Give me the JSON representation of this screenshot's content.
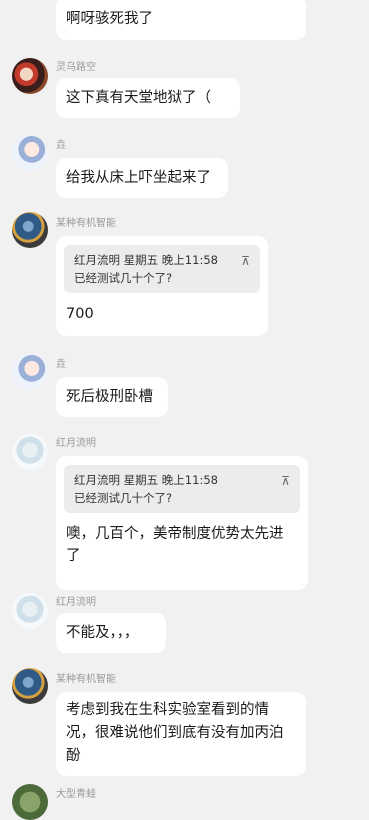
{
  "messages": [
    {
      "name": "",
      "text": "啊呀骇死我了",
      "avatar": ""
    },
    {
      "name": "灵乌路空",
      "text": "这下真有天堂地狱了（",
      "avatar": "fire-haired-avatar"
    },
    {
      "name": "垚",
      "text": "给我从床上吓坐起来了",
      "avatar": "anime-girl-avatar"
    },
    {
      "name": "某种有机智能",
      "avatar": "globe-avatar",
      "quote": {
        "header": "红月流明 星期五 晚上11:58",
        "text": "已经测试几十个了?",
        "icon": "up-arrow-icon",
        "mark": "⊼"
      },
      "text": "700"
    },
    {
      "name": "垚",
      "text": "死后极刑卧槽",
      "avatar": "anime-girl-avatar"
    },
    {
      "name": "红月流明",
      "avatar": "white-hair-avatar",
      "quote": {
        "header": "红月流明 星期五 晚上11:58",
        "text": "已经测试几十个了?",
        "icon": "up-arrow-icon",
        "mark": "⊼"
      },
      "text_line1": "噢，几百个，美帝制度优势太先进",
      "text_line2": "了"
    },
    {
      "name": "红月流明",
      "text": "不能及，，，",
      "avatar": "white-hair-avatar"
    },
    {
      "name": "某种有机智能",
      "avatar": "globe-avatar",
      "text_line1": "考虑到我在生科实验室看到的情",
      "text_line2": "况，很难说他们到底有没有加丙泊",
      "text_line3": "酚"
    },
    {
      "name": "大型青蛙",
      "avatar": "frog-avatar"
    }
  ]
}
